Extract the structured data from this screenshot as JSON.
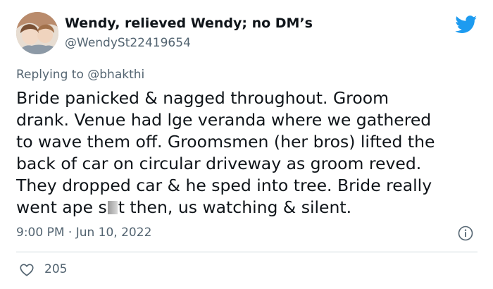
{
  "user": {
    "display_name": "Wendy, relieved Wendy; no DM’s",
    "handle": "@WendySt22419654",
    "avatar_icon": "profile-photo-avatar"
  },
  "brand": {
    "icon": "twitter-bird-icon",
    "color": "#1d9bf0"
  },
  "reply": {
    "prefix": "Replying to ",
    "mention": "@bhakthi"
  },
  "tweet": {
    "lines": [
      "Bride panicked & nagged throughout. Groom",
      "drank. Venue had lge veranda where we gathered",
      "to wave them off. Groomsmen (her bros) lifted the",
      "back of car on circular driveway as groom reved.",
      "They dropped car & he sped into tree. Bride really"
    ],
    "last_line_before": "went ape s",
    "last_line_after": "t then, us watching & silent."
  },
  "meta": {
    "timestamp": "9:00 PM · Jun 10, 2022",
    "info_icon": "info-icon"
  },
  "engagement": {
    "like_icon": "heart-icon",
    "like_count": "205"
  },
  "colors": {
    "text_primary": "#0f1419",
    "text_secondary": "#536471",
    "divider": "#cfd9de"
  }
}
